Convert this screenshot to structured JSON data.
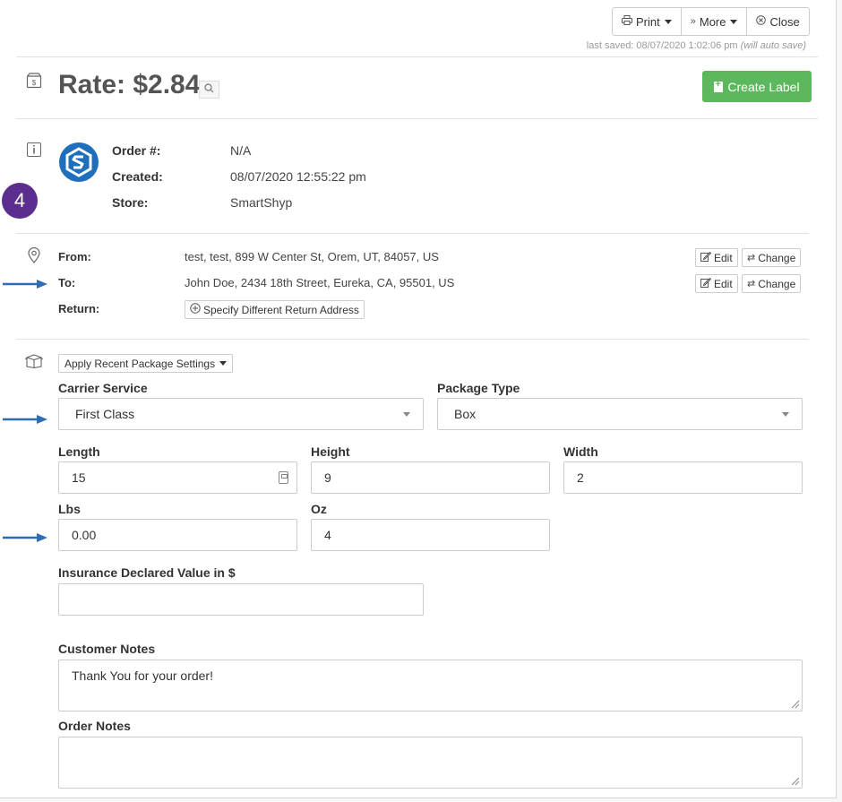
{
  "toolbar": {
    "print_label": "Print",
    "more_label": "More",
    "close_label": "Close"
  },
  "autosave": {
    "text": "last saved: 08/07/2020 1:02:06 pm",
    "note": "(will auto save)"
  },
  "rate": {
    "text": "Rate: $2.84"
  },
  "create_label_button": "Create Label",
  "order": {
    "order_label": "Order #:",
    "order_value": "N/A",
    "created_label": "Created:",
    "created_value": "08/07/2020 12:55:22 pm",
    "store_label": "Store:",
    "store_value": "SmartShyp"
  },
  "step_badge": "4",
  "addresses": {
    "from_label": "From:",
    "from_value": "test, test, 899 W Center St, Orem, UT, 84057, US",
    "to_label": "To:",
    "to_value": "John Doe, 2434 18th Street, Eureka, CA, 95501, US",
    "return_label": "Return:",
    "return_button": "Specify Different Return Address",
    "edit_label": "Edit",
    "change_label": "Change"
  },
  "package": {
    "recent_settings_button": "Apply Recent Package Settings",
    "carrier_label": "Carrier Service",
    "carrier_value": "First Class",
    "type_label": "Package Type",
    "type_value": "Box",
    "length_label": "Length",
    "length_value": "15",
    "height_label": "Height",
    "height_value": "9",
    "width_label": "Width",
    "width_value": "2",
    "lbs_label": "Lbs",
    "lbs_value": "0.00",
    "oz_label": "Oz",
    "oz_value": "4",
    "insurance_label": "Insurance Declared Value in $",
    "insurance_value": "",
    "customer_notes_label": "Customer Notes",
    "customer_notes_value": "Thank You for your order!",
    "order_notes_label": "Order Notes",
    "order_notes_value": ""
  },
  "colors": {
    "create_button": "#5cb85c",
    "step_badge": "#5b2d8e",
    "arrow": "#2e6db4",
    "logo": "#1f6fbd"
  }
}
